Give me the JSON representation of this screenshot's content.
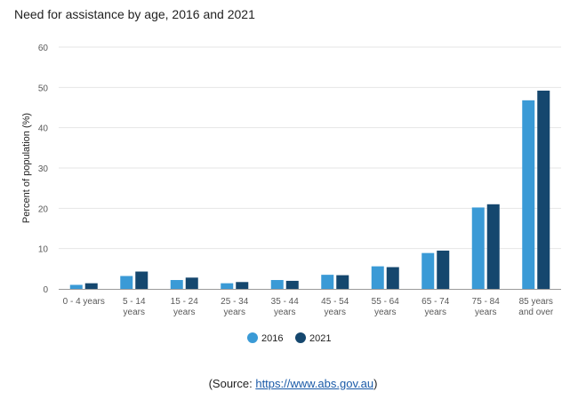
{
  "title": "Need for assistance by age, 2016 and 2021",
  "source": {
    "prefix": "(Source: ",
    "link": "https://www.abs.gov.au",
    "suffix": ")"
  },
  "colors": {
    "series_2016": "#3a9ad6",
    "series_2021": "#15476e",
    "grid": "#e6e6e6",
    "axis": "#9a9a9a",
    "text": "#595959"
  },
  "chart_data": {
    "type": "bar",
    "ylabel": "Percent of population (%)",
    "xlabel": "",
    "ylim": [
      0,
      60
    ],
    "yticks": [
      0,
      10,
      20,
      30,
      40,
      50,
      60
    ],
    "grid": true,
    "legend_position": "bottom",
    "categories": [
      [
        "0 - 4 years"
      ],
      [
        "5 - 14",
        "years"
      ],
      [
        "15 - 24",
        "years"
      ],
      [
        "25 - 34",
        "years"
      ],
      [
        "35 - 44",
        "years"
      ],
      [
        "45 - 54",
        "years"
      ],
      [
        "55 - 64",
        "years"
      ],
      [
        "65 - 74",
        "years"
      ],
      [
        "75 - 84",
        "years"
      ],
      [
        "85 years",
        "and over"
      ]
    ],
    "series": [
      {
        "name": "2016",
        "values": [
          1.0,
          3.2,
          2.2,
          1.4,
          2.2,
          3.5,
          5.6,
          8.9,
          20.2,
          46.8
        ]
      },
      {
        "name": "2021",
        "values": [
          1.4,
          4.3,
          2.8,
          1.7,
          2.0,
          3.4,
          5.4,
          9.5,
          21.0,
          49.2
        ]
      }
    ]
  }
}
